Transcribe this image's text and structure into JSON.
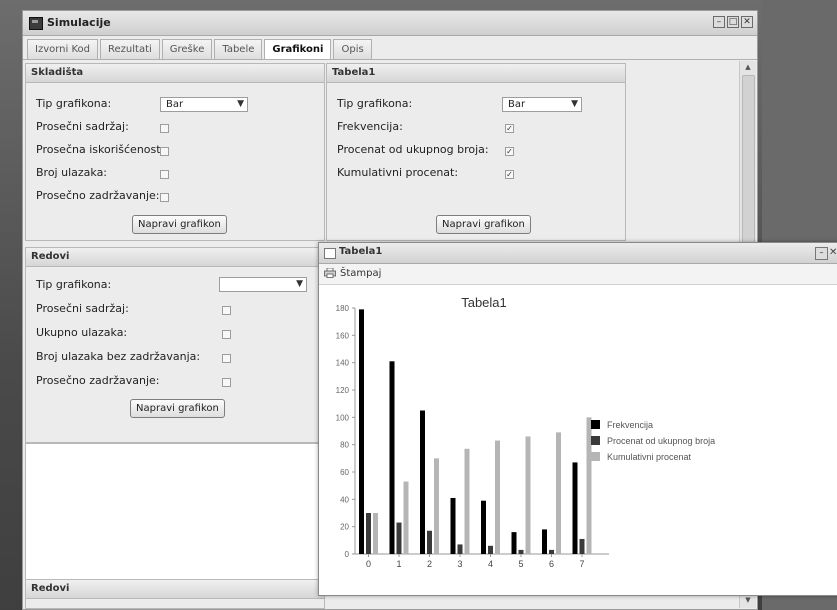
{
  "window": {
    "title": "Simulacije"
  },
  "tabs": [
    {
      "label": "Izvorni Kod"
    },
    {
      "label": "Rezultati"
    },
    {
      "label": "Greške"
    },
    {
      "label": "Tabele"
    },
    {
      "label": "Grafikoni"
    },
    {
      "label": "Opis"
    }
  ],
  "active_tab": "Grafikoni",
  "panel_skladista": {
    "title": "Skladišta",
    "chart_type_label": "Tip grafikona:",
    "chart_type_value": "Bar",
    "options": [
      {
        "label": "Prosečni sadržaj:",
        "checked": false
      },
      {
        "label": "Prosečna iskorišćenost:",
        "checked": false
      },
      {
        "label": "Broj ulazaka:",
        "checked": false
      },
      {
        "label": "Prosečno zadržavanje:",
        "checked": false
      }
    ],
    "button": "Napravi grafikon"
  },
  "panel_tabela1": {
    "title": "Tabela1",
    "chart_type_label": "Tip grafikona:",
    "chart_type_value": "Bar",
    "options": [
      {
        "label": "Frekvencija:",
        "checked": true
      },
      {
        "label": "Procenat od ukupnog broja:",
        "checked": true
      },
      {
        "label": "Kumulativni procenat:",
        "checked": true
      }
    ],
    "button": "Napravi grafikon"
  },
  "panel_redovi": {
    "title": "Redovi",
    "chart_type_label": "Tip grafikona:",
    "chart_type_value": "",
    "options": [
      {
        "label": "Prosečni sadržaj:",
        "checked": false
      },
      {
        "label": "Ukupno ulazaka:",
        "checked": false
      },
      {
        "label": "Broj ulazaka bez zadržavanja:",
        "checked": false
      },
      {
        "label": "Prosečno zadržavanje:",
        "checked": false
      }
    ],
    "button": "Napravi grafikon"
  },
  "panel_redovi2": {
    "title": "Redovi"
  },
  "popup": {
    "title": "Tabela1",
    "print_label": "Štampaj"
  },
  "check_mark": "✓",
  "icons": [
    "app-icon",
    "minimize-icon",
    "maximize-icon",
    "close-icon",
    "printer-icon",
    "chevron-down-icon"
  ],
  "chart_data": {
    "type": "bar",
    "title": "Tabela1",
    "categories": [
      "0",
      "1",
      "2",
      "3",
      "4",
      "5",
      "6",
      "7"
    ],
    "series": [
      {
        "name": "Frekvencija",
        "color": "#000000",
        "values": [
          179,
          141,
          105,
          41,
          39,
          16,
          18,
          67
        ]
      },
      {
        "name": "Procenat od ukupnog broja",
        "color": "#3a3a3a",
        "values": [
          30,
          23,
          17,
          7,
          6,
          3,
          3,
          11
        ]
      },
      {
        "name": "Kumulativni procenat",
        "color": "#b5b5b5",
        "values": [
          30,
          53,
          70,
          77,
          83,
          86,
          89,
          100
        ]
      }
    ],
    "ylim": [
      0,
      180
    ],
    "yticks": [
      0,
      20,
      40,
      60,
      80,
      100,
      120,
      140,
      160,
      180
    ],
    "grid": false,
    "legend_position": "right"
  }
}
